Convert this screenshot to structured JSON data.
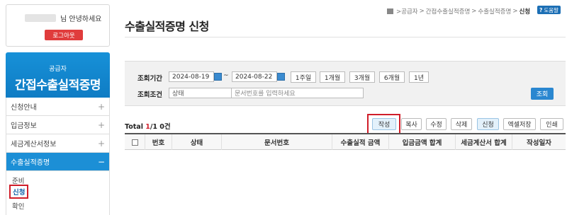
{
  "sidebar": {
    "greeting": "님 안녕하세요",
    "logout": "로그아웃",
    "head_sub": "공급자",
    "head_title": "간접수출실적증명",
    "items": [
      {
        "label": "신청안내",
        "sign": "+"
      },
      {
        "label": "입금정보",
        "sign": "+"
      },
      {
        "label": "세금계산서정보",
        "sign": "+"
      },
      {
        "label": "수출실적증명",
        "sign": "−"
      }
    ],
    "subitems": [
      "준비",
      "신청",
      "확인"
    ]
  },
  "header": {
    "title": "수출실적증명 신청",
    "breadcrumb": [
      ">공급자",
      ">",
      "간접수출실적증명",
      ">",
      "수출실적증명",
      ">"
    ],
    "breadcrumb_current": "신청",
    "help": "도움말"
  },
  "search": {
    "period_label": "조회기간",
    "date_from": "2024-08-19",
    "date_sep": "~",
    "date_to": "2024-08-22",
    "periods": [
      "1주일",
      "1개월",
      "3개월",
      "6개월",
      "1년"
    ],
    "cond_label": "조회조건",
    "select_value": "상태",
    "doc_placeholder": "문서번호를 입력하세요",
    "search_btn": "조회"
  },
  "toolbar": {
    "total_prefix": "Total ",
    "total_page": "1",
    "total_rest": "/1 0건",
    "buttons": [
      "작성",
      "복사",
      "수정",
      "삭제",
      "신청",
      "엑셀저장",
      "인쇄"
    ]
  },
  "table": {
    "headers": [
      "번호",
      "상태",
      "문서번호",
      "수출실적 금액",
      "입금금액 합계",
      "세금계산서 합계",
      "작성일자"
    ]
  },
  "colors": {
    "accent": "#1c8fd6",
    "highlight": "#d01e2a"
  }
}
